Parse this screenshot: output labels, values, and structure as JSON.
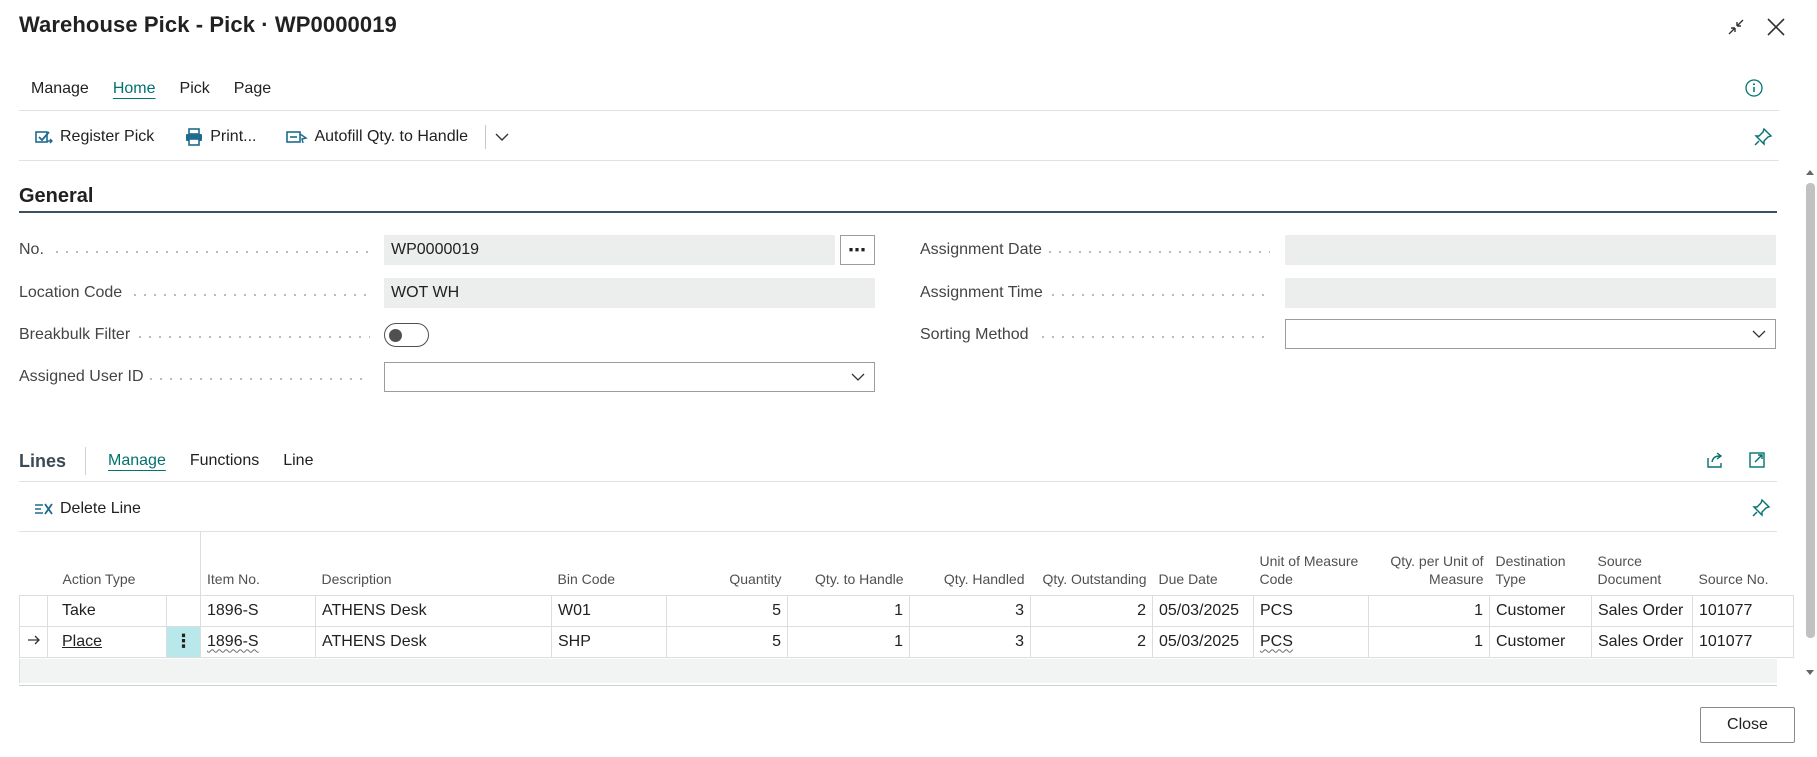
{
  "window": {
    "title": "Warehouse Pick - Pick · WP0000019"
  },
  "menu": {
    "tabs": [
      {
        "label": "Manage",
        "active": false
      },
      {
        "label": "Home",
        "active": true
      },
      {
        "label": "Pick",
        "active": false
      },
      {
        "label": "Page",
        "active": false
      }
    ]
  },
  "toolbar": {
    "register_pick": "Register Pick",
    "print": "Print...",
    "autofill": "Autofill Qty. to Handle"
  },
  "general": {
    "title": "General",
    "fields": {
      "no": {
        "label": "No.",
        "value": "WP0000019"
      },
      "location_code": {
        "label": "Location Code",
        "value": "WOT WH"
      },
      "breakbulk_filter": {
        "label": "Breakbulk Filter",
        "value": false
      },
      "assigned_user_id": {
        "label": "Assigned User ID",
        "value": ""
      },
      "assignment_date": {
        "label": "Assignment Date",
        "value": ""
      },
      "assignment_time": {
        "label": "Assignment Time",
        "value": ""
      },
      "sorting_method": {
        "label": "Sorting Method",
        "value": ""
      }
    }
  },
  "lines": {
    "title": "Lines",
    "tabs": [
      {
        "label": "Manage",
        "active": true
      },
      {
        "label": "Functions",
        "active": false
      },
      {
        "label": "Line",
        "active": false
      }
    ],
    "delete_line": "Delete Line",
    "columns": {
      "action_type": "Action Type",
      "item_no": "Item No.",
      "description": "Description",
      "bin_code": "Bin Code",
      "quantity": "Quantity",
      "qty_to_handle": "Qty. to Handle",
      "qty_handled": "Qty. Handled",
      "qty_outstanding": "Qty. Outstanding",
      "due_date": "Due Date",
      "uom_code": "Unit of Measure Code",
      "qty_per_uom": "Qty. per Unit of Measure",
      "destination_type": "Destination Type",
      "source_document": "Source Document",
      "source_no": "Source No."
    },
    "rows": [
      {
        "action_type": "Take",
        "item_no": "1896-S",
        "description": "ATHENS Desk",
        "bin_code": "W01",
        "quantity": "5",
        "qty_to_handle": "1",
        "qty_handled": "3",
        "qty_outstanding": "2",
        "due_date": "05/03/2025",
        "uom_code": "PCS",
        "qty_per_uom": "1",
        "destination_type": "Customer",
        "source_document": "Sales Order",
        "source_no": "101077"
      },
      {
        "action_type": "Place",
        "item_no": "1896-S",
        "description": "ATHENS Desk",
        "bin_code": "SHP",
        "quantity": "5",
        "qty_to_handle": "1",
        "qty_handled": "3",
        "qty_outstanding": "2",
        "due_date": "05/03/2025",
        "uom_code": "PCS",
        "qty_per_uom": "1",
        "destination_type": "Customer",
        "source_document": "Sales Order",
        "source_no": "101077"
      }
    ]
  },
  "footer": {
    "close": "Close"
  },
  "colors": {
    "accent": "#00736f",
    "section_rule": "#3a5163",
    "selected_cell": "#b8e8ea"
  }
}
